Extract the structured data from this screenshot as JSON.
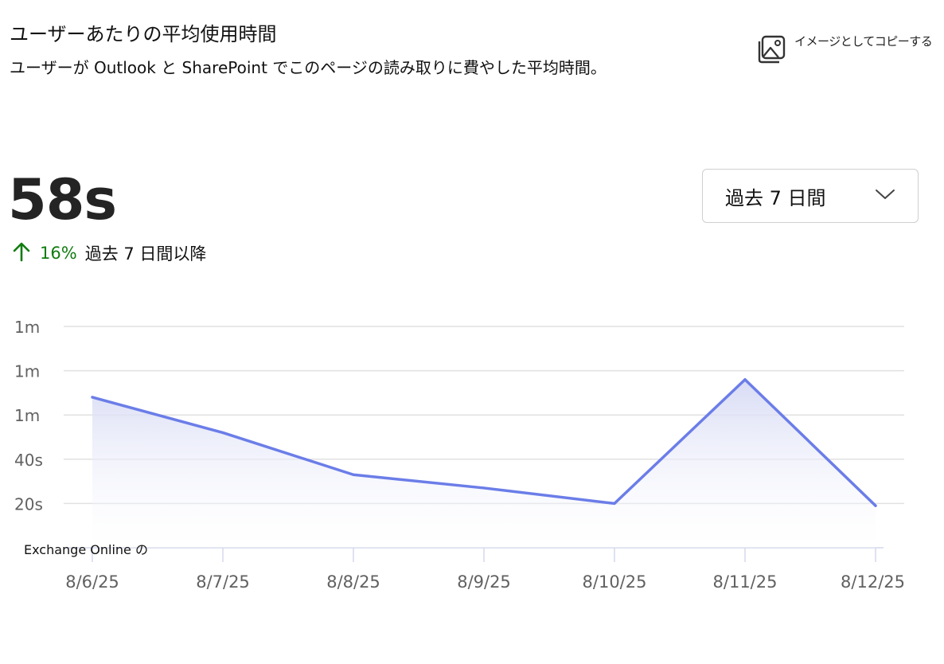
{
  "header": {
    "title": "ユーザーあたりの平均使用時間",
    "subtitle": "ユーザーが Outlook と SharePoint でこのページの読み取りに費やした平均時間。"
  },
  "actions": {
    "copy_image_label": "イメージとしてコピーする",
    "copy_icon": "image-icon"
  },
  "summary": {
    "value": "58s",
    "change_percent": "16%",
    "change_direction": "up",
    "change_period": "過去 7 日間以降",
    "change_color": "#107c10"
  },
  "period_select": {
    "selected": "過去 7 日間"
  },
  "colors": {
    "series_line": "#6b7de8",
    "series_fill_top": "#d6daf4",
    "gridline": "#e1e1e1",
    "axis_text": "#616161"
  },
  "chart_data": {
    "type": "area",
    "title": "",
    "xlabel": "",
    "ylabel": "",
    "categories": [
      "8/6/25",
      "8/7/25",
      "8/8/25",
      "8/9/25",
      "8/10/25",
      "8/11/25",
      "8/12/25"
    ],
    "series": [
      {
        "name": "Exchange Online の",
        "values": [
          68,
          52,
          33,
          27,
          20,
          76,
          19
        ]
      }
    ],
    "y_ticks": [
      {
        "value": 20,
        "label": "20s"
      },
      {
        "value": 40,
        "label": "40s"
      },
      {
        "value": 60,
        "label": "1m"
      },
      {
        "value": 80,
        "label": "1m"
      },
      {
        "value": 100,
        "label": "1m"
      }
    ],
    "ylim": [
      0,
      100
    ],
    "y_unit": "seconds",
    "grid": true,
    "legend_position": "bottom-left"
  }
}
